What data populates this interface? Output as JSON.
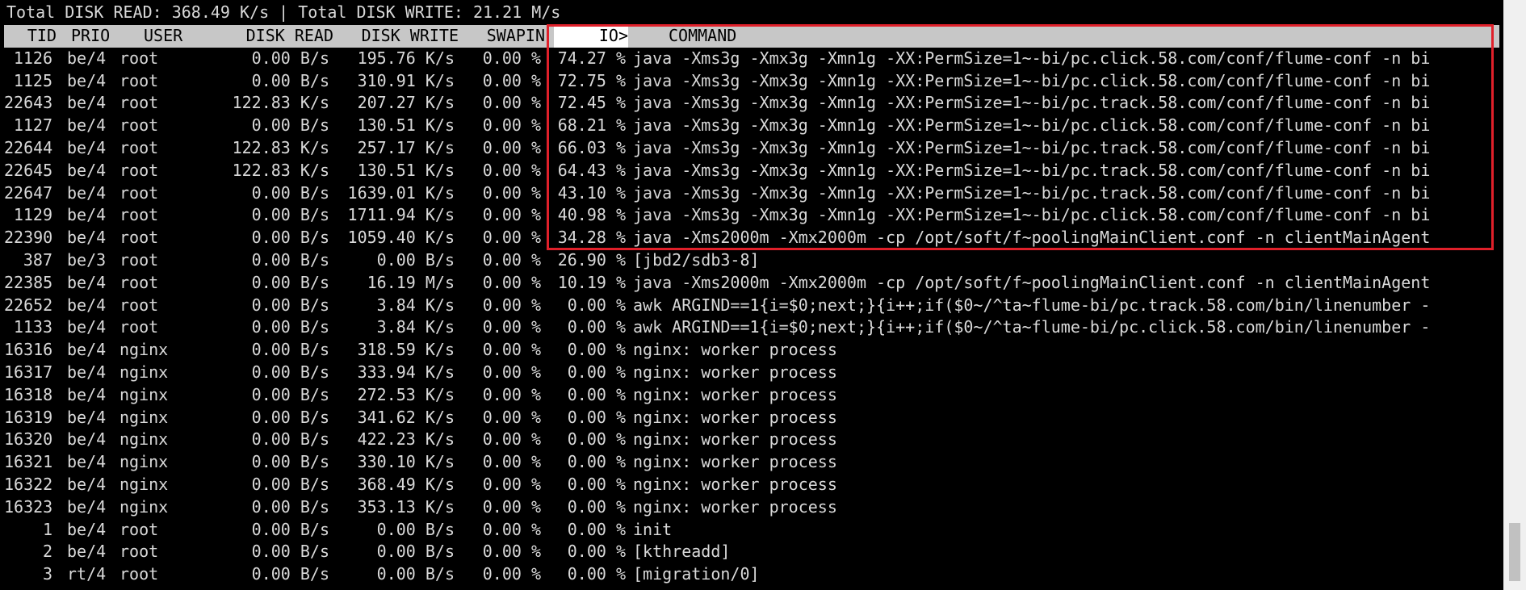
{
  "summary": "Total DISK READ: 368.49 K/s | Total DISK WRITE: 21.21 M/s",
  "colors": {
    "background": "#000000",
    "text": "#d9d9d9",
    "header_bar": "#c7c7c7",
    "highlight": "#e0202a"
  },
  "columns": {
    "tid": "TID",
    "prio": "PRIO",
    "user": "USER",
    "disk_read": "DISK READ",
    "disk_write": "DISK WRITE",
    "swapin": "SWAPIN",
    "io": "IO>",
    "command": "COMMAND"
  },
  "rows": [
    {
      "tid": "1126",
      "prio": "be/4",
      "user": "root",
      "disk_read": "0.00 B/s",
      "disk_write": "195.76 K/s",
      "swapin": "0.00 %",
      "io": "74.27 %",
      "command": "java -Xms3g -Xmx3g -Xmn1g -XX:PermSize=1~-bi/pc.click.58.com/conf/flume-conf -n bi"
    },
    {
      "tid": "1125",
      "prio": "be/4",
      "user": "root",
      "disk_read": "0.00 B/s",
      "disk_write": "310.91 K/s",
      "swapin": "0.00 %",
      "io": "72.75 %",
      "command": "java -Xms3g -Xmx3g -Xmn1g -XX:PermSize=1~-bi/pc.click.58.com/conf/flume-conf -n bi"
    },
    {
      "tid": "22643",
      "prio": "be/4",
      "user": "root",
      "disk_read": "122.83 K/s",
      "disk_write": "207.27 K/s",
      "swapin": "0.00 %",
      "io": "72.45 %",
      "command": "java -Xms3g -Xmx3g -Xmn1g -XX:PermSize=1~-bi/pc.track.58.com/conf/flume-conf -n bi"
    },
    {
      "tid": "1127",
      "prio": "be/4",
      "user": "root",
      "disk_read": "0.00 B/s",
      "disk_write": "130.51 K/s",
      "swapin": "0.00 %",
      "io": "68.21 %",
      "command": "java -Xms3g -Xmx3g -Xmn1g -XX:PermSize=1~-bi/pc.click.58.com/conf/flume-conf -n bi"
    },
    {
      "tid": "22644",
      "prio": "be/4",
      "user": "root",
      "disk_read": "122.83 K/s",
      "disk_write": "257.17 K/s",
      "swapin": "0.00 %",
      "io": "66.03 %",
      "command": "java -Xms3g -Xmx3g -Xmn1g -XX:PermSize=1~-bi/pc.track.58.com/conf/flume-conf -n bi"
    },
    {
      "tid": "22645",
      "prio": "be/4",
      "user": "root",
      "disk_read": "122.83 K/s",
      "disk_write": "130.51 K/s",
      "swapin": "0.00 %",
      "io": "64.43 %",
      "command": "java -Xms3g -Xmx3g -Xmn1g -XX:PermSize=1~-bi/pc.track.58.com/conf/flume-conf -n bi"
    },
    {
      "tid": "22647",
      "prio": "be/4",
      "user": "root",
      "disk_read": "0.00 B/s",
      "disk_write": "1639.01 K/s",
      "swapin": "0.00 %",
      "io": "43.10 %",
      "command": "java -Xms3g -Xmx3g -Xmn1g -XX:PermSize=1~-bi/pc.track.58.com/conf/flume-conf -n bi"
    },
    {
      "tid": "1129",
      "prio": "be/4",
      "user": "root",
      "disk_read": "0.00 B/s",
      "disk_write": "1711.94 K/s",
      "swapin": "0.00 %",
      "io": "40.98 %",
      "command": "java -Xms3g -Xmx3g -Xmn1g -XX:PermSize=1~-bi/pc.click.58.com/conf/flume-conf -n bi"
    },
    {
      "tid": "22390",
      "prio": "be/4",
      "user": "root",
      "disk_read": "0.00 B/s",
      "disk_write": "1059.40 K/s",
      "swapin": "0.00 %",
      "io": "34.28 %",
      "command": "java -Xms2000m -Xmx2000m -cp /opt/soft/f~poolingMainClient.conf -n clientMainAgent"
    },
    {
      "tid": "387",
      "prio": "be/3",
      "user": "root",
      "disk_read": "0.00 B/s",
      "disk_write": "0.00 B/s",
      "swapin": "0.00 %",
      "io": "26.90 %",
      "command": "[jbd2/sdb3-8]"
    },
    {
      "tid": "22385",
      "prio": "be/4",
      "user": "root",
      "disk_read": "0.00 B/s",
      "disk_write": "16.19 M/s",
      "swapin": "0.00 %",
      "io": "10.19 %",
      "command": "java -Xms2000m -Xmx2000m -cp /opt/soft/f~poolingMainClient.conf -n clientMainAgent"
    },
    {
      "tid": "22652",
      "prio": "be/4",
      "user": "root",
      "disk_read": "0.00 B/s",
      "disk_write": "3.84 K/s",
      "swapin": "0.00 %",
      "io": "0.00 %",
      "command": "awk ARGIND==1{i=$0;next;}{i++;if($0~/^ta~flume-bi/pc.track.58.com/bin/linenumber -"
    },
    {
      "tid": "1133",
      "prio": "be/4",
      "user": "root",
      "disk_read": "0.00 B/s",
      "disk_write": "3.84 K/s",
      "swapin": "0.00 %",
      "io": "0.00 %",
      "command": "awk ARGIND==1{i=$0;next;}{i++;if($0~/^ta~flume-bi/pc.click.58.com/bin/linenumber -"
    },
    {
      "tid": "16316",
      "prio": "be/4",
      "user": "nginx",
      "disk_read": "0.00 B/s",
      "disk_write": "318.59 K/s",
      "swapin": "0.00 %",
      "io": "0.00 %",
      "command": "nginx: worker process"
    },
    {
      "tid": "16317",
      "prio": "be/4",
      "user": "nginx",
      "disk_read": "0.00 B/s",
      "disk_write": "333.94 K/s",
      "swapin": "0.00 %",
      "io": "0.00 %",
      "command": "nginx: worker process"
    },
    {
      "tid": "16318",
      "prio": "be/4",
      "user": "nginx",
      "disk_read": "0.00 B/s",
      "disk_write": "272.53 K/s",
      "swapin": "0.00 %",
      "io": "0.00 %",
      "command": "nginx: worker process"
    },
    {
      "tid": "16319",
      "prio": "be/4",
      "user": "nginx",
      "disk_read": "0.00 B/s",
      "disk_write": "341.62 K/s",
      "swapin": "0.00 %",
      "io": "0.00 %",
      "command": "nginx: worker process"
    },
    {
      "tid": "16320",
      "prio": "be/4",
      "user": "nginx",
      "disk_read": "0.00 B/s",
      "disk_write": "422.23 K/s",
      "swapin": "0.00 %",
      "io": "0.00 %",
      "command": "nginx: worker process"
    },
    {
      "tid": "16321",
      "prio": "be/4",
      "user": "nginx",
      "disk_read": "0.00 B/s",
      "disk_write": "330.10 K/s",
      "swapin": "0.00 %",
      "io": "0.00 %",
      "command": "nginx: worker process"
    },
    {
      "tid": "16322",
      "prio": "be/4",
      "user": "nginx",
      "disk_read": "0.00 B/s",
      "disk_write": "368.49 K/s",
      "swapin": "0.00 %",
      "io": "0.00 %",
      "command": "nginx: worker process"
    },
    {
      "tid": "16323",
      "prio": "be/4",
      "user": "nginx",
      "disk_read": "0.00 B/s",
      "disk_write": "353.13 K/s",
      "swapin": "0.00 %",
      "io": "0.00 %",
      "command": "nginx: worker process"
    },
    {
      "tid": "1",
      "prio": "be/4",
      "user": "root",
      "disk_read": "0.00 B/s",
      "disk_write": "0.00 B/s",
      "swapin": "0.00 %",
      "io": "0.00 %",
      "command": "init"
    },
    {
      "tid": "2",
      "prio": "be/4",
      "user": "root",
      "disk_read": "0.00 B/s",
      "disk_write": "0.00 B/s",
      "swapin": "0.00 %",
      "io": "0.00 %",
      "command": "[kthreadd]"
    },
    {
      "tid": "3",
      "prio": "rt/4",
      "user": "root",
      "disk_read": "0.00 B/s",
      "disk_write": "0.00 B/s",
      "swapin": "0.00 %",
      "io": "0.00 %",
      "command": "[migration/0]"
    }
  ]
}
